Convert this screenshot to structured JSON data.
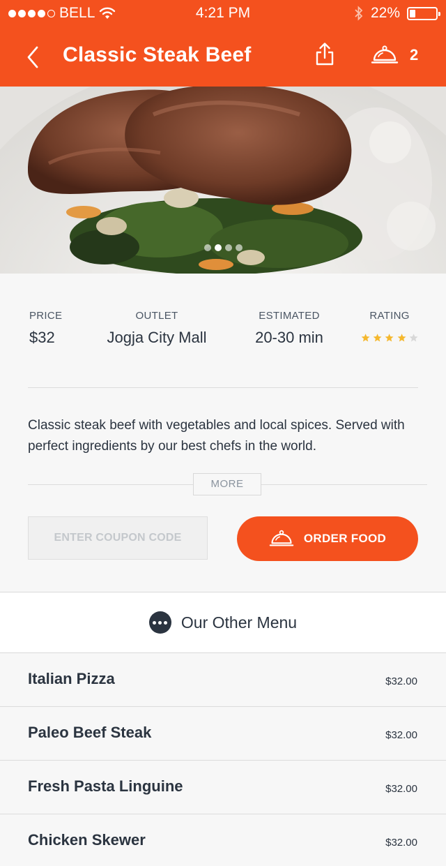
{
  "status_bar": {
    "carrier": "BELL",
    "time": "4:21 PM",
    "battery": "22%",
    "battery_level": 0.22,
    "signal_bars": 4,
    "icons": [
      "wifi-icon",
      "bluetooth-icon",
      "battery-icon"
    ]
  },
  "nav": {
    "title": "Classic Steak Beef",
    "cart_count": "2",
    "icons": [
      "back-icon",
      "share-icon",
      "cloche-icon"
    ]
  },
  "hero": {
    "slides": 4,
    "active_slide": 2
  },
  "info": {
    "price_label": "PRICE",
    "price_value": "$32",
    "outlet_label": "OUTLET",
    "outlet_value": "Jogja City Mall",
    "estimated_label": "ESTIMATED",
    "estimated_value": "20-30 min",
    "rating_label": "RATING",
    "rating": 4,
    "rating_max": 5
  },
  "description": "Classic steak beef with vegetables and local spices.  Served with perfect ingredients by our best chefs in the world.",
  "more_label": "MORE",
  "coupon": {
    "placeholder": "ENTER COUPON CODE"
  },
  "order_label": "ORDER FOOD",
  "other_menu": {
    "title": "Our Other Menu",
    "items": [
      {
        "name": "Italian Pizza",
        "price": "$32.00"
      },
      {
        "name": "Paleo Beef Steak",
        "price": "$32.00"
      },
      {
        "name": "Fresh Pasta Linguine",
        "price": "$32.00"
      },
      {
        "name": "Chicken Skewer",
        "price": "$32.00"
      }
    ]
  },
  "colors": {
    "accent": "#f4511e",
    "text_dark": "#2b3440",
    "star": "#f5b82e",
    "star_empty": "#d8d8d8"
  }
}
